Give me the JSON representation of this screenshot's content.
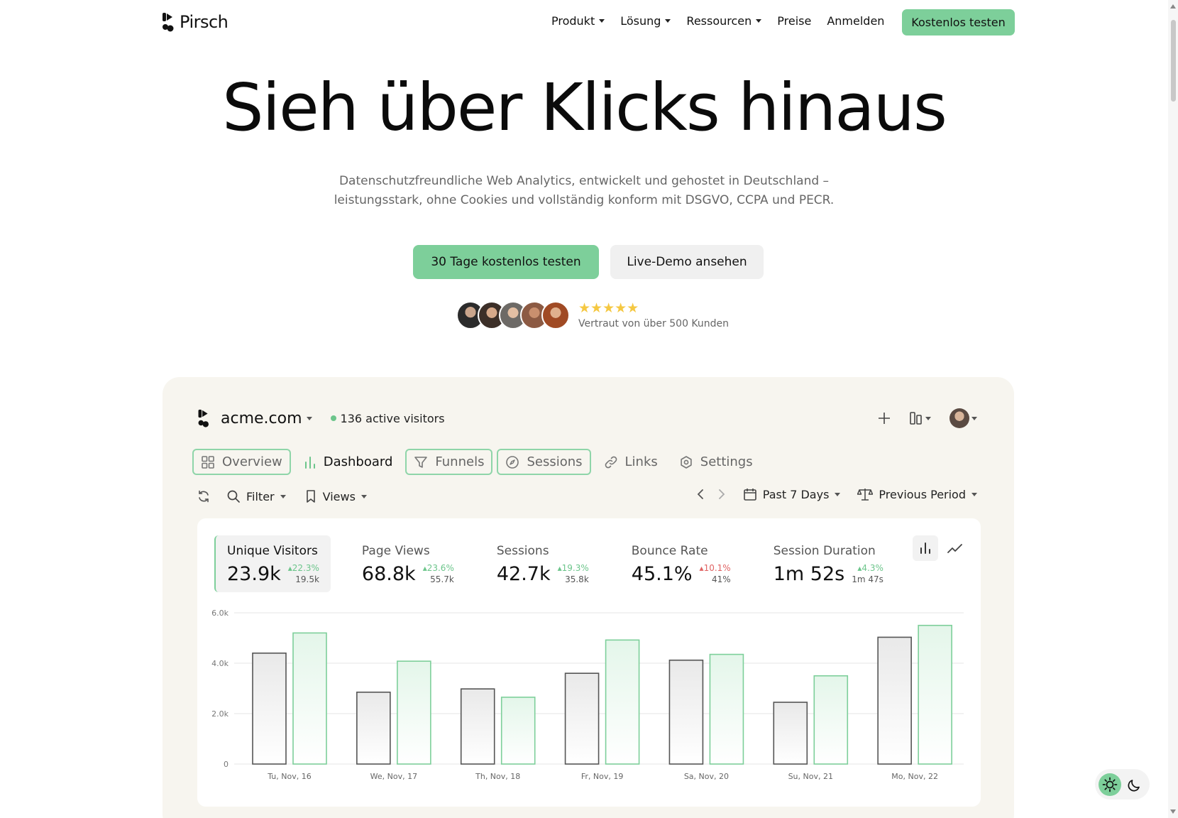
{
  "nav": {
    "brand": "Pirsch",
    "links": [
      {
        "label": "Produkt",
        "dropdown": true
      },
      {
        "label": "Lösung",
        "dropdown": true
      },
      {
        "label": "Ressourcen",
        "dropdown": true
      },
      {
        "label": "Preise",
        "dropdown": false
      },
      {
        "label": "Anmelden",
        "dropdown": false
      }
    ],
    "cta": "Kostenlos testen"
  },
  "hero": {
    "title": "Sieh über Klicks hinaus",
    "subtitle_line1": "Datenschutzfreundliche Web Analytics, entwickelt und gehostet in Deutschland –",
    "subtitle_line2": "leistungsstark, ohne Cookies und vollständig konform mit DSGVO, CCPA und PECR.",
    "primary_button": "30 Tage kostenlos testen",
    "secondary_button": "Live-Demo ansehen",
    "stars": "★★★★★",
    "trust_text": "Vertraut von über 500 Kunden"
  },
  "colors": {
    "accent": "#7dcf9a",
    "positive": "#6cc58b",
    "negative": "#e06363",
    "panel_bg": "#f7f5ef"
  },
  "dashboard": {
    "site": "acme.com",
    "active_visitors": "136 active visitors",
    "tabs": [
      {
        "label": "Overview",
        "icon": "grid-icon"
      },
      {
        "label": "Dashboard",
        "icon": "bar-chart-icon"
      },
      {
        "label": "Funnels",
        "icon": "funnel-icon"
      },
      {
        "label": "Sessions",
        "icon": "compass-icon"
      },
      {
        "label": "Links",
        "icon": "link-icon"
      },
      {
        "label": "Settings",
        "icon": "gear-icon"
      }
    ],
    "toolbar": {
      "filter": "Filter",
      "views": "Views",
      "period": "Past 7 Days",
      "compare": "Previous Period"
    },
    "metrics": [
      {
        "label": "Unique Visitors",
        "value": "23.9k",
        "delta": "22.3%",
        "direction": "up",
        "previous": "19.5k"
      },
      {
        "label": "Page Views",
        "value": "68.8k",
        "delta": "23.6%",
        "direction": "up",
        "previous": "55.7k"
      },
      {
        "label": "Sessions",
        "value": "42.7k",
        "delta": "19.3%",
        "direction": "up",
        "previous": "35.8k"
      },
      {
        "label": "Bounce Rate",
        "value": "45.1%",
        "delta": "10.1%",
        "direction": "up",
        "previous": "41%"
      },
      {
        "label": "Session Duration",
        "value": "1m 52s",
        "delta": "4.3%",
        "direction": "up",
        "previous": "1m 47s"
      }
    ]
  },
  "chart_data": {
    "type": "bar",
    "categories": [
      "Tu, Nov, 16",
      "We, Nov, 17",
      "Th, Nov, 18",
      "Fr, Nov, 19",
      "Sa, Nov, 20",
      "Su, Nov, 21",
      "Mo, Nov, 22"
    ],
    "series": [
      {
        "values": [
          4400,
          2850,
          2980,
          3600,
          4120,
          2450,
          5030
        ],
        "color": "#555555"
      },
      {
        "values": [
          5200,
          4080,
          2650,
          4920,
          4350,
          3500,
          5500
        ],
        "color": "#7dcf9a"
      }
    ],
    "yticks": [
      "0",
      "2.0k",
      "4.0k",
      "6.0k"
    ],
    "ylim": [
      0,
      6000
    ],
    "grid": true
  }
}
